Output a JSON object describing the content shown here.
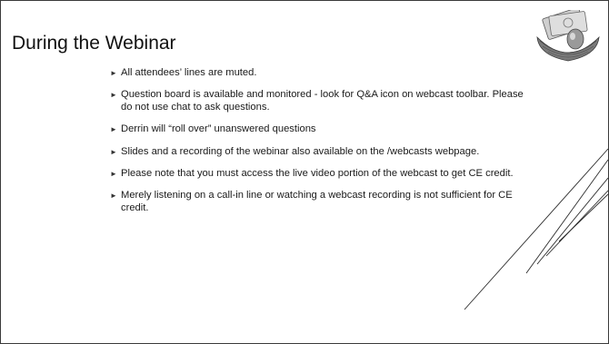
{
  "slide": {
    "title": "During the Webinar",
    "bullet_marker": "►",
    "bullets": [
      {
        "text": "All attendees’ lines are muted."
      },
      {
        "text": "Question board is available and monitored - look for Q&A icon on webcast toolbar. Please do not use chat to ask questions."
      },
      {
        "text": "Derrin will “roll over” unanswered questions"
      },
      {
        "text": "Slides and a recording of the webinar also available on the /webcasts webpage."
      },
      {
        "text": "Please note that you must access the live video portion of the webcast to get CE credit."
      },
      {
        "text": "Merely listening on a call-in line  or watching a webcast recording is not sufficient for CE credit."
      }
    ]
  },
  "decoration": {
    "image": "money-nest-egg-icon",
    "line_color": "#2b2b2b"
  }
}
